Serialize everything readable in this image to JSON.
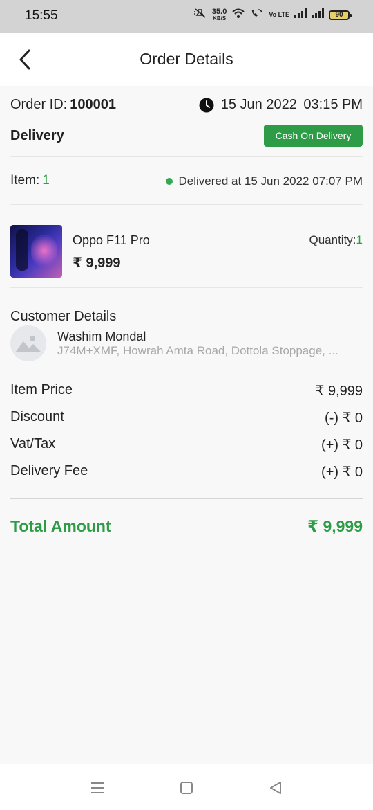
{
  "status_bar": {
    "time": "15:55",
    "speed_value": "35.0",
    "speed_unit": "KB/S",
    "volte": "Vo LTE",
    "battery": "90",
    "icons": [
      "mute-icon",
      "wifi-icon",
      "wifi-call-icon",
      "signal-icon",
      "signal-icon",
      "battery-icon"
    ]
  },
  "header": {
    "title": "Order Details",
    "back_icon": "back-arrow-icon"
  },
  "order": {
    "id_label": "Order ID:",
    "id_value": "100001",
    "date": "15 Jun 2022",
    "time": "03:15 PM",
    "type": "Delivery",
    "payment_method": "Cash On Delivery"
  },
  "items": {
    "label": "Item:",
    "count": "1",
    "status_date": "Delivered at 15 Jun 2022",
    "status_time": "07:07 PM"
  },
  "product": {
    "name": "Oppo F11 Pro",
    "price": "₹ 9,999",
    "quantity_label": "Quantity:",
    "quantity_value": "1"
  },
  "customer": {
    "title": "Customer Details",
    "name": "Washim Mondal",
    "address": "J74M+XMF, Howrah Amta Road, Dottola Stoppage, ..."
  },
  "summary": {
    "rows": [
      {
        "label": "Item Price",
        "value": "₹ 9,999"
      },
      {
        "label": "Discount",
        "value": "(-) ₹ 0"
      },
      {
        "label": "Vat/Tax",
        "value": "(+) ₹ 0"
      },
      {
        "label": "Delivery Fee",
        "value": "(+) ₹ 0"
      }
    ],
    "total_label": "Total Amount",
    "total_value": "₹ 9,999"
  },
  "colors": {
    "accent": "#2e9c47",
    "status_dot": "#34a853"
  }
}
